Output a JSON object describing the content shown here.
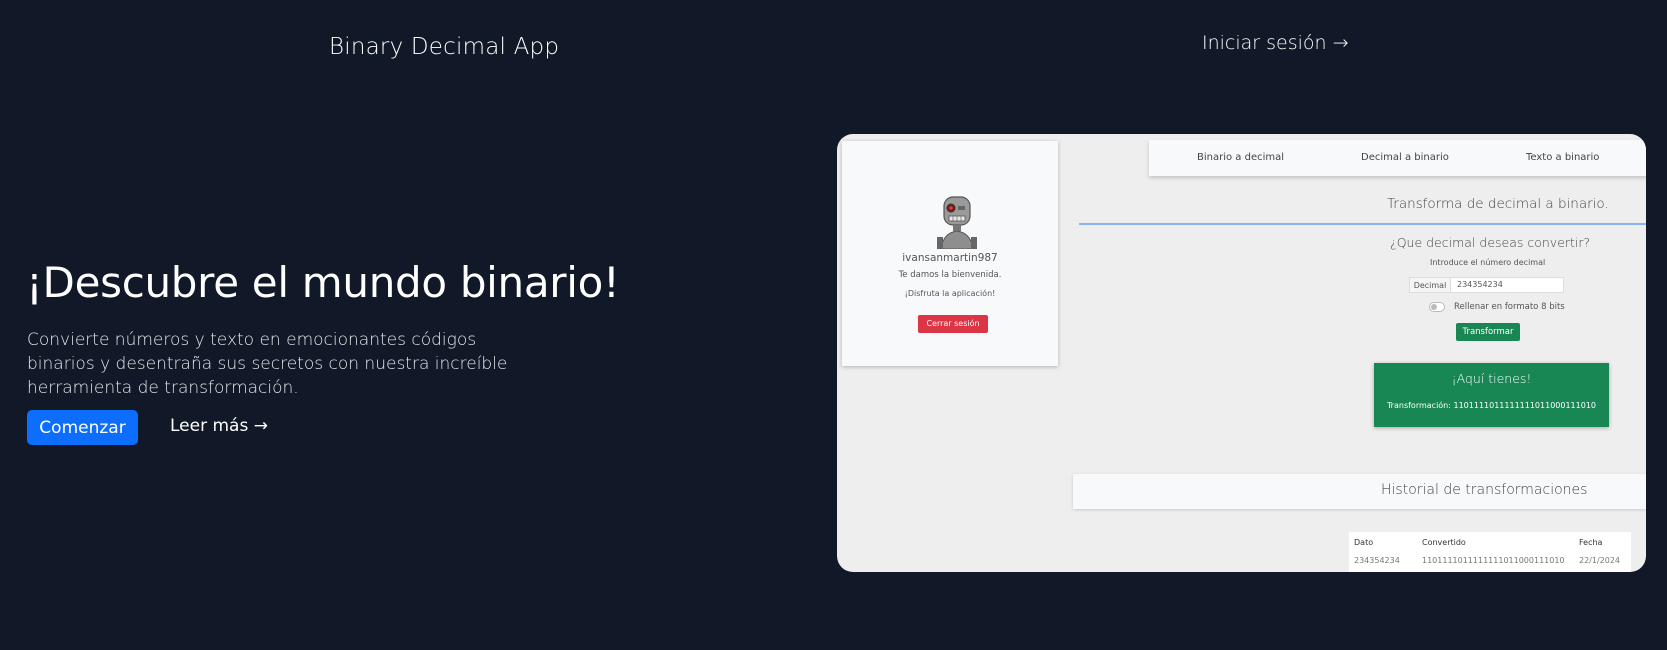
{
  "header": {
    "brand": "Binary Decimal App",
    "login_label": "Iniciar sesión →"
  },
  "hero": {
    "title": "¡Descubre el mundo binario!",
    "description": "Convierte números y texto en emocionantes códigos binarios y desentraña sus secretos con nuestra increíble herramienta de transformación.",
    "primary_button": "Comenzar",
    "secondary_link": "Leer más →"
  },
  "preview": {
    "profile": {
      "username": "ivansanmartin987",
      "welcome": "Te damos la bienvenida.",
      "enjoy": "¡Disfruta la aplicación!",
      "logout_button": "Cerrar sesión"
    },
    "nav": {
      "items": [
        "Binario a decimal",
        "Decimal a binario",
        "Texto a binario"
      ]
    },
    "converter": {
      "section_title": "Transforma de decimal a binario.",
      "question": "¿Que decimal deseas convertir?",
      "hint": "Introduce el número decimal",
      "input_prefix": "Decimal",
      "input_value": "234354234",
      "toggle_label": "Rellenar en formato 8 bits",
      "submit_button": "Transformar"
    },
    "result": {
      "title": "¡Aquí tienes!",
      "value": "Transformación: 1101111011111111011000111010"
    },
    "history": {
      "title": "Historial de transformaciones",
      "columns": [
        "Dato",
        "Convertido",
        "Fecha"
      ],
      "rows": [
        [
          "234354234",
          "1101111011111111011000111010",
          "22/1/2024"
        ]
      ]
    }
  },
  "colors": {
    "background": "#111827",
    "primary": "#0d6efd",
    "danger": "#dc3545",
    "success": "#198754"
  }
}
